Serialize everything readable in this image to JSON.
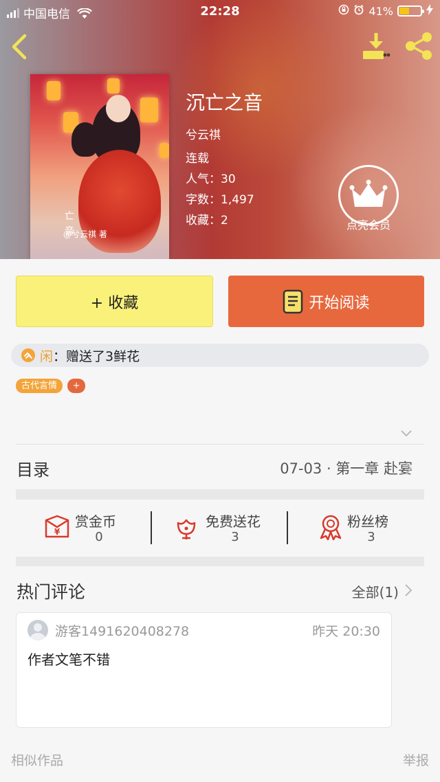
{
  "status_bar": {
    "carrier": "中国电信",
    "time": "22:28",
    "battery": "41%",
    "battery_level": 0.41,
    "battery_color": "#f5c518"
  },
  "nav": {
    "back_icon": "chevron-left-icon",
    "download_icon": "download-icon",
    "share_icon": "share-icon",
    "icon_color": "#f3e356"
  },
  "book": {
    "title": "沉亡之音",
    "author": "兮云祺",
    "status": "连载",
    "popularity": "人气：30",
    "word_count": "字数：1,497",
    "favorites": "收藏：2",
    "cover": {
      "title_chars": "亡\n音",
      "author_credit": "@兮云祺 著"
    }
  },
  "vip": {
    "label": "点亮会员",
    "icon": "crown-icon"
  },
  "actions": {
    "collect_label": "+ 收藏",
    "read_label": "开始阅读",
    "collect_color": "#f9f17a",
    "read_color": "#e8683e"
  },
  "gift": {
    "user": "闲",
    "text": "：赠送了3鲜花",
    "icon": "hand-icon"
  },
  "tags": {
    "items": [
      "古代言情"
    ],
    "add_label": "+"
  },
  "toc": {
    "label": "目录",
    "latest": "07-03 · 第一章 赴宴"
  },
  "stats": [
    {
      "name": "赏金币",
      "value": "0",
      "icon": "red-envelope-icon"
    },
    {
      "name": "免费送花",
      "value": "3",
      "icon": "flower-icon"
    },
    {
      "name": "粉丝榜",
      "value": "3",
      "icon": "medal-icon"
    }
  ],
  "comments": {
    "title": "热门评论",
    "all_label": "全部(1)",
    "items": [
      {
        "user": "游客1491620408278",
        "time": "昨天 20:30",
        "text": "作者文笔不错"
      }
    ]
  },
  "footer": {
    "similar": "相似作品",
    "report": "举报"
  }
}
